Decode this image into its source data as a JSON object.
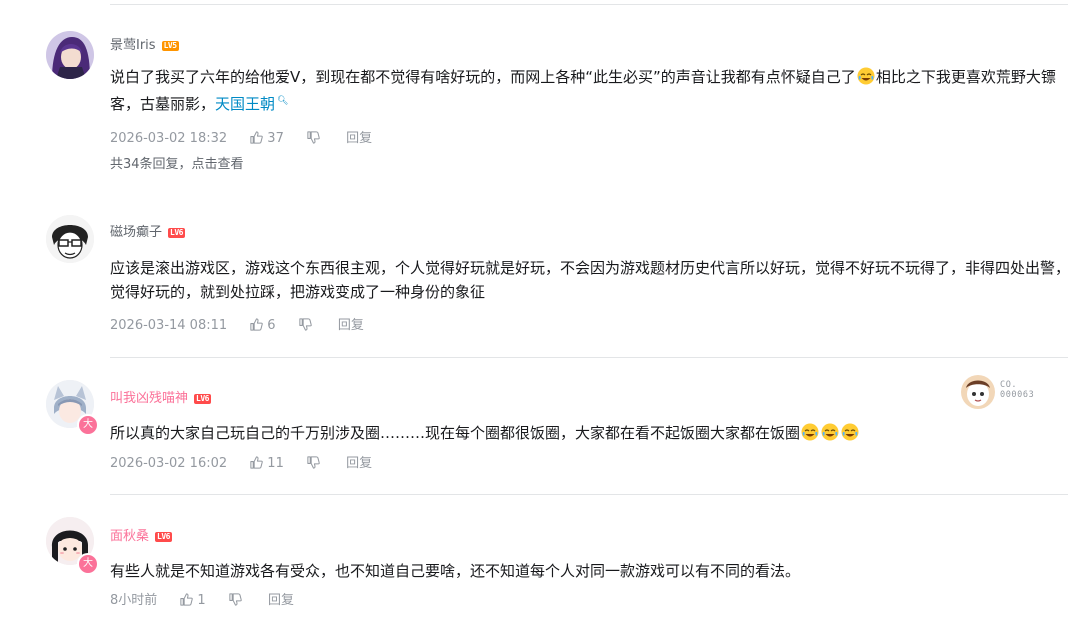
{
  "comments": [
    {
      "username": "景莺Iris",
      "level": "LV5",
      "content_pre": "说白了我买了六年的给他爱V，到现在都不觉得有啥好玩的，而网上各种“此生必买”的声音让我都有点怀疑自己了",
      "content_post": "相比之下我更喜欢荒野大镖客，古墓丽影，",
      "content_link": "天国王朝",
      "time": "2026-03-02 18:32",
      "likes": "37",
      "reply_label": "回复",
      "replies_summary": "共34条回复，点击查看"
    },
    {
      "username": "磁场癫子",
      "level": "LV6",
      "content": "应该是滚出游戏区，游戏这个东西很主观，个人觉得好玩就是好玩，不会因为游戏题材历史代言所以好玩，觉得不好玩不玩得了，非得四处出警，觉得好玩的，就到处拉踩，把游戏变成了一种身份的象征",
      "time": "2026-03-14 08:11",
      "likes": "6",
      "reply_label": "回复"
    },
    {
      "username": "叫我凶残喵神",
      "level": "LV6",
      "avatar_badge": "大",
      "content": "所以真的大家自己玩自己的千万别涉及圈………现在每个圈都很饭圈，大家都在看不起饭圈大家都在饭圈",
      "time": "2026-03-02 16:02",
      "likes": "11",
      "reply_label": "回复",
      "fan_badge_label": "CO.",
      "fan_badge_number": "000063"
    },
    {
      "username": "面秋桑",
      "level": "LV6",
      "avatar_badge": "大",
      "content": "有些人就是不知道游戏各有受众，也不知道自己要啥，还不知道每个人对同一款游戏可以有不同的看法。",
      "time": "8小时前",
      "likes": "1",
      "reply_label": "回复"
    }
  ],
  "colors": {
    "vip_name": "#fb7299",
    "link": "#008ac5",
    "meta": "#9499a0",
    "lv5": "#ff9500",
    "lv6": "#ff4b4b"
  },
  "icons": [
    "thumbs-up-icon",
    "thumbs-down-icon",
    "laugh-cry-emoji",
    "search-icon"
  ]
}
